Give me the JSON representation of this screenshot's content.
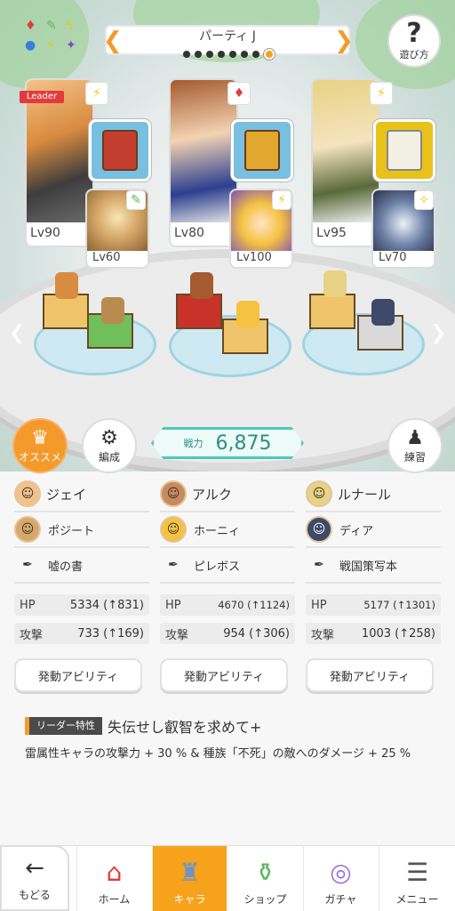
{
  "header": {
    "party_name": "パーティ J",
    "page_count": 8,
    "active_page": 8,
    "help_label": "遊び方"
  },
  "element_icons": [
    "diamond-red",
    "leaf-green",
    "flash-yellow",
    "star-purple"
  ],
  "team": [
    {
      "main": {
        "level": "Lv90",
        "element": "flash-yellow",
        "leader_tag": "Leader"
      },
      "sub": {
        "level": "Lv60",
        "element": "leaf-green"
      },
      "book_color": "#79bfe0"
    },
    {
      "main": {
        "level": "Lv80",
        "element": "diamond-red"
      },
      "sub": {
        "level": "Lv100",
        "element": "flash-yellow"
      },
      "book_color": "#79bfe0"
    },
    {
      "main": {
        "level": "Lv95",
        "element": "flash-yellow"
      },
      "sub": {
        "level": "Lv70",
        "element": "star-white"
      },
      "book_color": "#e8c21b"
    }
  ],
  "buttons": {
    "recommend": "オススメ",
    "formation": "編成",
    "practice": "練習"
  },
  "power": {
    "label": "戦力",
    "value": "6,875"
  },
  "members": [
    {
      "main_name": "ジェイ",
      "sub_name": "ポジート",
      "item": "嘘の書",
      "hp_label": "HP",
      "hp": "5334 (↑831)",
      "atk_label": "攻撃",
      "atk": "733 (↑169)",
      "ability": "発動アビリティ"
    },
    {
      "main_name": "アルク",
      "sub_name": "ホーニィ",
      "item": "ピレボス",
      "hp_label": "HP",
      "hp": "4670 (↑1124)",
      "atk_label": "攻撃",
      "atk": "954 (↑306)",
      "ability": "発動アビリティ"
    },
    {
      "main_name": "ルナール",
      "sub_name": "ディア",
      "item": "戦国策写本",
      "hp_label": "HP",
      "hp": "5177 (↑1301)",
      "atk_label": "攻撃",
      "atk": "1003 (↑258)",
      "ability": "発動アビリティ"
    }
  ],
  "leader_skill": {
    "tag": "リーダー特性",
    "name": "失伝せし叡智を求めて+",
    "description": "雷属性キャラの攻撃力 + 30 % & 種族「不死」の敵へのダメージ + 25 %"
  },
  "nav": {
    "back": "もどる",
    "items": [
      "ホーム",
      "キャラ",
      "ショップ",
      "ガチャ",
      "メニュー"
    ],
    "active": "キャラ"
  },
  "colors": {
    "accent_orange": "#f7a21b",
    "teal": "#4fc7b9"
  }
}
